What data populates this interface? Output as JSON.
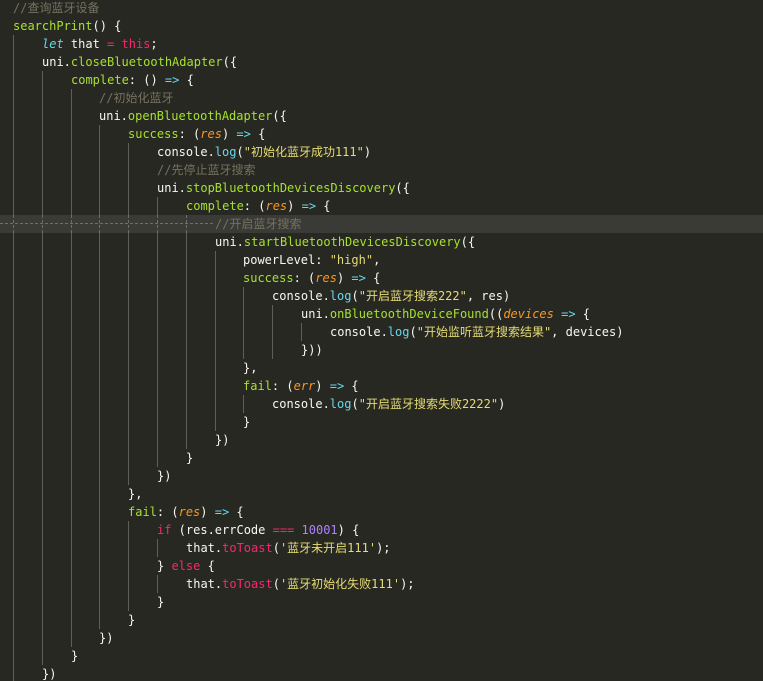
{
  "editor": {
    "background": "#272822",
    "current_line": 12,
    "colors": {
      "comment": "#75715E",
      "keyword": "#F92672",
      "storage": "#66D9EF",
      "function": "#A6E22E",
      "string": "#E6DB74",
      "number": "#AE81FF",
      "parameter": "#FD971F",
      "plain": "#F8F8F2"
    },
    "lines": [
      {
        "indent": 0,
        "tokens": [
          {
            "t": "//查询蓝牙设备",
            "c": "comment"
          }
        ]
      },
      {
        "indent": 0,
        "tokens": [
          {
            "t": "searchPrint",
            "c": "fn"
          },
          {
            "t": "() {",
            "c": "plain"
          }
        ]
      },
      {
        "indent": 1,
        "tokens": [
          {
            "t": "let",
            "c": "kwi"
          },
          {
            "t": " that ",
            "c": "plain"
          },
          {
            "t": "=",
            "c": "kw"
          },
          {
            "t": " ",
            "c": "plain"
          },
          {
            "t": "this",
            "c": "kw"
          },
          {
            "t": ";",
            "c": "plain"
          }
        ]
      },
      {
        "indent": 1,
        "tokens": [
          {
            "t": "uni.",
            "c": "plain"
          },
          {
            "t": "closeBluetoothAdapter",
            "c": "fn"
          },
          {
            "t": "({",
            "c": "plain"
          }
        ]
      },
      {
        "indent": 2,
        "tokens": [
          {
            "t": "complete",
            "c": "fn"
          },
          {
            "t": ": () ",
            "c": "plain"
          },
          {
            "t": "=>",
            "c": "arrow"
          },
          {
            "t": " {",
            "c": "plain"
          }
        ]
      },
      {
        "indent": 3,
        "tokens": [
          {
            "t": "//初始化蓝牙",
            "c": "comment"
          }
        ]
      },
      {
        "indent": 3,
        "tokens": [
          {
            "t": "uni.",
            "c": "plain"
          },
          {
            "t": "openBluetoothAdapter",
            "c": "fn"
          },
          {
            "t": "({",
            "c": "plain"
          }
        ]
      },
      {
        "indent": 4,
        "tokens": [
          {
            "t": "success",
            "c": "fn"
          },
          {
            "t": ": (",
            "c": "plain"
          },
          {
            "t": "res",
            "c": "param"
          },
          {
            "t": ") ",
            "c": "plain"
          },
          {
            "t": "=>",
            "c": "arrow"
          },
          {
            "t": " {",
            "c": "plain"
          }
        ]
      },
      {
        "indent": 5,
        "tokens": [
          {
            "t": "console.",
            "c": "plain"
          },
          {
            "t": "log",
            "c": "arrow"
          },
          {
            "t": "(",
            "c": "plain"
          },
          {
            "t": "\"初始化蓝牙成功111\"",
            "c": "str"
          },
          {
            "t": ")",
            "c": "plain"
          }
        ]
      },
      {
        "indent": 5,
        "tokens": [
          {
            "t": "//先停止蓝牙搜索",
            "c": "comment"
          }
        ]
      },
      {
        "indent": 5,
        "tokens": [
          {
            "t": "uni.",
            "c": "plain"
          },
          {
            "t": "stopBluetoothDevicesDiscovery",
            "c": "fn"
          },
          {
            "t": "({",
            "c": "plain"
          }
        ]
      },
      {
        "indent": 6,
        "tokens": [
          {
            "t": "complete",
            "c": "fn"
          },
          {
            "t": ": (",
            "c": "plain"
          },
          {
            "t": "res",
            "c": "param"
          },
          {
            "t": ") ",
            "c": "plain"
          },
          {
            "t": "=>",
            "c": "arrow"
          },
          {
            "t": " {",
            "c": "plain"
          }
        ]
      },
      {
        "indent": 7,
        "tokens": [
          {
            "t": "//开启蓝牙搜索",
            "c": "comment"
          }
        ]
      },
      {
        "indent": 7,
        "tokens": [
          {
            "t": "uni.",
            "c": "plain"
          },
          {
            "t": "startBluetoothDevicesDiscovery",
            "c": "fn"
          },
          {
            "t": "({",
            "c": "plain"
          }
        ]
      },
      {
        "indent": 8,
        "tokens": [
          {
            "t": "powerLevel: ",
            "c": "plain"
          },
          {
            "t": "\"high\"",
            "c": "str"
          },
          {
            "t": ",",
            "c": "plain"
          }
        ]
      },
      {
        "indent": 8,
        "tokens": [
          {
            "t": "success",
            "c": "fn"
          },
          {
            "t": ": (",
            "c": "plain"
          },
          {
            "t": "res",
            "c": "param"
          },
          {
            "t": ") ",
            "c": "plain"
          },
          {
            "t": "=>",
            "c": "arrow"
          },
          {
            "t": " {",
            "c": "plain"
          }
        ]
      },
      {
        "indent": 9,
        "tokens": [
          {
            "t": "console.",
            "c": "plain"
          },
          {
            "t": "log",
            "c": "arrow"
          },
          {
            "t": "(",
            "c": "plain"
          },
          {
            "t": "\"开启蓝牙搜索222\"",
            "c": "str"
          },
          {
            "t": ", res)",
            "c": "plain"
          }
        ]
      },
      {
        "indent": 10,
        "tokens": [
          {
            "t": "uni.",
            "c": "plain"
          },
          {
            "t": "onBluetoothDeviceFound",
            "c": "fn"
          },
          {
            "t": "((",
            "c": "plain"
          },
          {
            "t": "devices",
            "c": "param"
          },
          {
            "t": " ",
            "c": "plain"
          },
          {
            "t": "=>",
            "c": "arrow"
          },
          {
            "t": " {",
            "c": "plain"
          }
        ]
      },
      {
        "indent": 11,
        "tokens": [
          {
            "t": "console.",
            "c": "plain"
          },
          {
            "t": "log",
            "c": "arrow"
          },
          {
            "t": "(",
            "c": "plain"
          },
          {
            "t": "\"开始监听蓝牙搜索结果\"",
            "c": "str"
          },
          {
            "t": ", devices)",
            "c": "plain"
          }
        ]
      },
      {
        "indent": 10,
        "tokens": [
          {
            "t": "}))",
            "c": "plain"
          }
        ]
      },
      {
        "indent": 8,
        "tokens": [
          {
            "t": "},",
            "c": "plain"
          }
        ]
      },
      {
        "indent": 8,
        "tokens": [
          {
            "t": "fail",
            "c": "fn"
          },
          {
            "t": ": (",
            "c": "plain"
          },
          {
            "t": "err",
            "c": "param"
          },
          {
            "t": ") ",
            "c": "plain"
          },
          {
            "t": "=>",
            "c": "arrow"
          },
          {
            "t": " {",
            "c": "plain"
          }
        ]
      },
      {
        "indent": 9,
        "tokens": [
          {
            "t": "console.",
            "c": "plain"
          },
          {
            "t": "log",
            "c": "arrow"
          },
          {
            "t": "(",
            "c": "plain"
          },
          {
            "t": "\"开启蓝牙搜索失败2222\"",
            "c": "str"
          },
          {
            "t": ")",
            "c": "plain"
          }
        ]
      },
      {
        "indent": 8,
        "tokens": [
          {
            "t": "}",
            "c": "plain"
          }
        ]
      },
      {
        "indent": 7,
        "tokens": [
          {
            "t": "})",
            "c": "plain"
          }
        ]
      },
      {
        "indent": 6,
        "tokens": [
          {
            "t": "}",
            "c": "plain"
          }
        ]
      },
      {
        "indent": 5,
        "tokens": [
          {
            "t": "})",
            "c": "plain"
          }
        ]
      },
      {
        "indent": 4,
        "tokens": [
          {
            "t": "},",
            "c": "plain"
          }
        ]
      },
      {
        "indent": 4,
        "tokens": [
          {
            "t": "fail",
            "c": "fn"
          },
          {
            "t": ": (",
            "c": "plain"
          },
          {
            "t": "res",
            "c": "param"
          },
          {
            "t": ") ",
            "c": "plain"
          },
          {
            "t": "=>",
            "c": "arrow"
          },
          {
            "t": " {",
            "c": "plain"
          }
        ]
      },
      {
        "indent": 5,
        "tokens": [
          {
            "t": "if",
            "c": "kw"
          },
          {
            "t": " (res.errCode ",
            "c": "plain"
          },
          {
            "t": "===",
            "c": "kw"
          },
          {
            "t": " ",
            "c": "plain"
          },
          {
            "t": "10001",
            "c": "num"
          },
          {
            "t": ") {",
            "c": "plain"
          }
        ]
      },
      {
        "indent": 6,
        "tokens": [
          {
            "t": "that.",
            "c": "plain"
          },
          {
            "t": "toToast",
            "c": "kw"
          },
          {
            "t": "(",
            "c": "plain"
          },
          {
            "t": "'蓝牙未开启111'",
            "c": "str"
          },
          {
            "t": ");",
            "c": "plain"
          }
        ]
      },
      {
        "indent": 5,
        "tokens": [
          {
            "t": "} ",
            "c": "plain"
          },
          {
            "t": "else",
            "c": "kw"
          },
          {
            "t": " {",
            "c": "plain"
          }
        ]
      },
      {
        "indent": 6,
        "tokens": [
          {
            "t": "that.",
            "c": "plain"
          },
          {
            "t": "toToast",
            "c": "kw"
          },
          {
            "t": "(",
            "c": "plain"
          },
          {
            "t": "'蓝牙初始化失败111'",
            "c": "str"
          },
          {
            "t": ");",
            "c": "plain"
          }
        ]
      },
      {
        "indent": 5,
        "tokens": [
          {
            "t": "}",
            "c": "plain"
          }
        ]
      },
      {
        "indent": 4,
        "tokens": [
          {
            "t": "}",
            "c": "plain"
          }
        ]
      },
      {
        "indent": 3,
        "tokens": [
          {
            "t": "})",
            "c": "plain"
          }
        ]
      },
      {
        "indent": 2,
        "tokens": [
          {
            "t": "}",
            "c": "plain"
          }
        ]
      },
      {
        "indent": 1,
        "tokens": [
          {
            "t": "})",
            "c": "plain"
          }
        ]
      }
    ]
  }
}
